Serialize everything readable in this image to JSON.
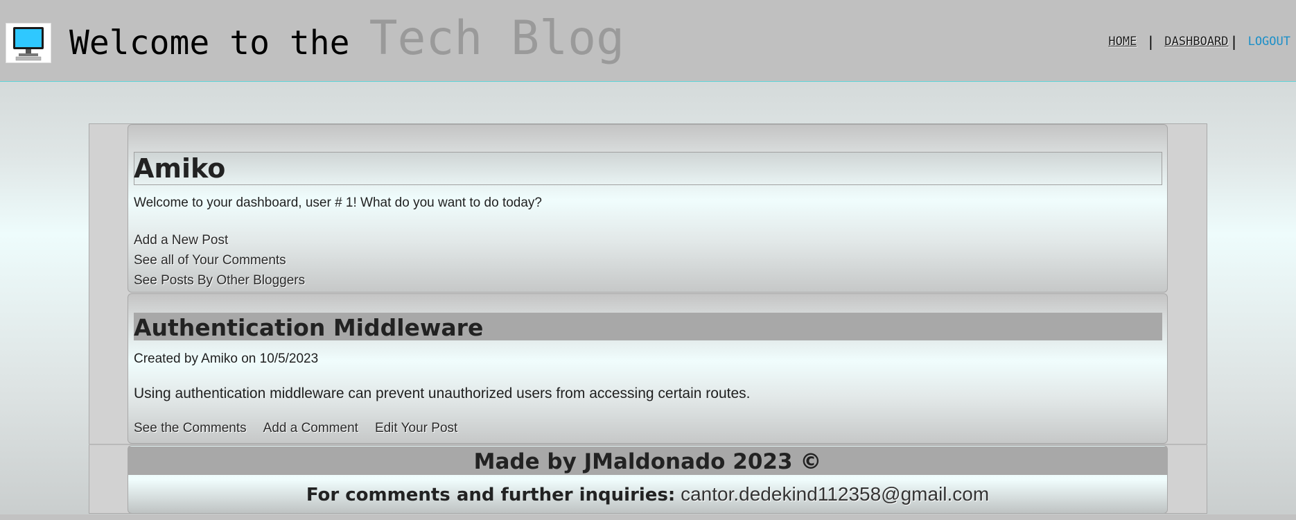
{
  "header": {
    "title_main": "Welcome to the",
    "title_accent": "Tech Blog",
    "logo_icon": "computer-monitor-icon",
    "nav": {
      "home": "HOME",
      "separator": "|",
      "dashboard": "DASHBOARD",
      "logout": "LOGOUT"
    }
  },
  "user_card": {
    "name": "Amiko",
    "welcome": "Welcome to your dashboard, user # 1! What do you want to do today?",
    "actions": [
      "Add a New Post",
      "See all of Your Comments",
      "See Posts By Other Bloggers"
    ]
  },
  "post": {
    "title": "Authentication Middleware",
    "meta": "Created by Amiko on 10/5/2023",
    "body": "Using authentication middleware can prevent unauthorized users from accessing certain routes.",
    "actions": [
      "See the Comments",
      "Add a Comment",
      "Edit Your Post"
    ]
  },
  "footer": {
    "made_by": "Made by JMaldonado 2023 ©",
    "contact_label": "For comments and further inquiries:",
    "email": "cantor.dedekind112358@gmail.com"
  },
  "colors": {
    "header_bg": "#c0c0c0",
    "accent_link": "#1b8fc8",
    "header_border": "#5fd3d8",
    "title_bar": "#a8a8a8"
  }
}
